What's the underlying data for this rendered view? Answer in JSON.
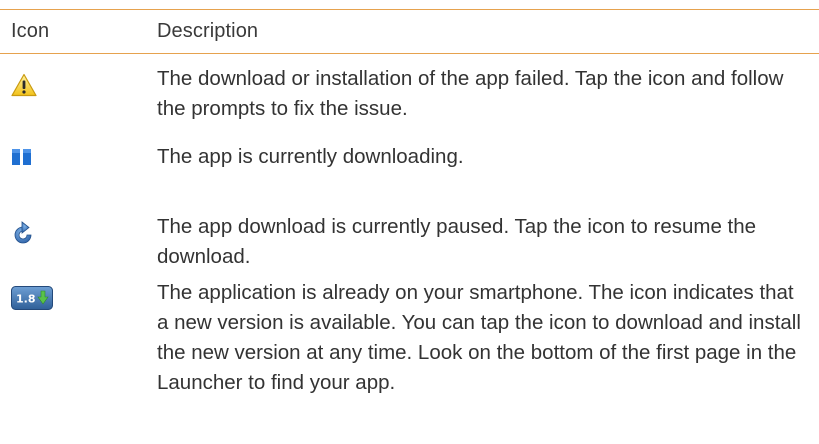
{
  "header": {
    "icon_col": "Icon",
    "description_col": "Description"
  },
  "rows": [
    {
      "icon": "warning-icon",
      "description": "The download or installation of the app failed. Tap the icon and follow the prompts to fix the issue."
    },
    {
      "icon": "pause-icon",
      "description": "The app is currently downloading."
    },
    {
      "icon": "refresh-icon",
      "description": "The app download is currently paused. Tap the icon to resume the download."
    },
    {
      "icon": "update-version-icon",
      "icon_text": "1.8",
      "description": "The application is already on your smartphone. The icon indicates that a new version is available. You can tap the icon to download and install the new version at any time. Look on the bottom of the first page in the Launcher to find your app."
    }
  ],
  "colors": {
    "rule": "#e6a24e",
    "warning": "#f2c21a",
    "pause": "#1f6fd1",
    "refresh": "#2f78c8",
    "badge": "#3f7ab9"
  }
}
